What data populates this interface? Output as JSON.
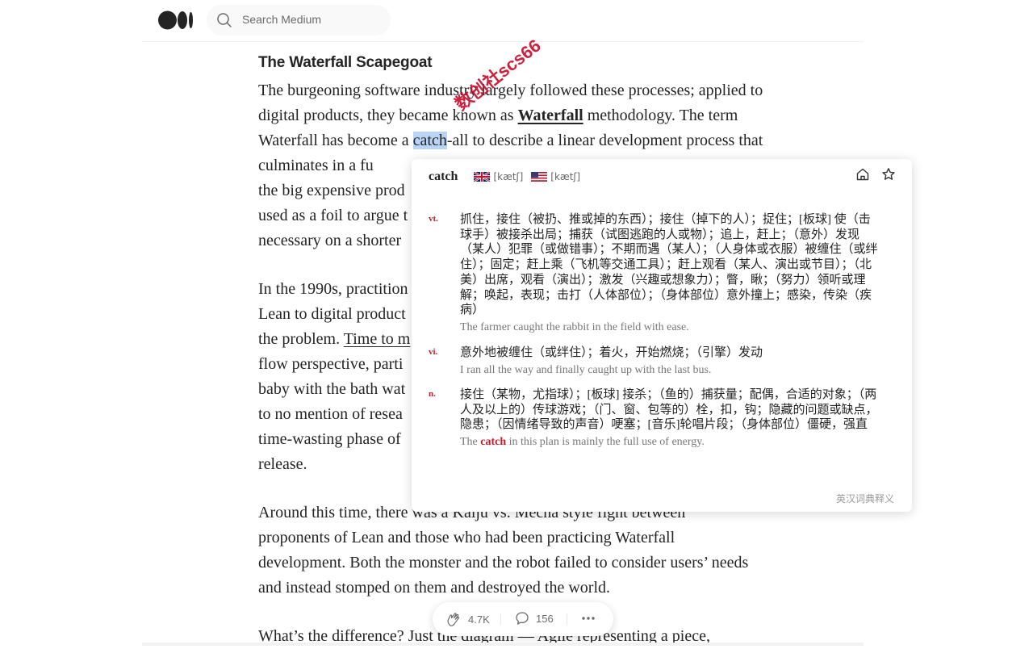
{
  "header": {
    "logo_icon": "medium-logo-icon",
    "search_placeholder": "Search Medium"
  },
  "article": {
    "section_title": "The Waterfall Scapegoat",
    "p1": {
      "t1": "The burgeoning software industry largely followed these processes; applied to digital products, they became known as ",
      "link": "Waterfall",
      "t2": " methodology. The term Waterfall has become a ",
      "highlight": "catch",
      "t3": "-all to describe a linear development process that culminates in a fu",
      "line5": "the big expensive prod",
      "line6": "used as a foil to argue t",
      "line7": "necessary on a shorter"
    },
    "p2": {
      "l1": "In the 1990s, practition",
      "l2": "Lean to digital product",
      "l3a": "the problem. ",
      "l3link": "Time to m",
      "l4": "flow perspective, parti",
      "l5": "baby with the bath wat",
      "l6": "to no mention of resea",
      "l7": "time-wasting phase of",
      "l8": "release."
    },
    "p3": {
      "l1": "Around this time, there was a Kaiju vs. Mecha style fight between",
      "l2": "proponents of Lean and those who had been practicing Waterfall",
      "l3": "development. Both the monster and the robot failed to consider users’ needs",
      "l4": "and instead stomped on them and destroyed the world."
    },
    "p4": {
      "l1": "What’s the difference? Just the diagram — Agile representing a piece,"
    }
  },
  "watermark": "数创社scs66",
  "dictionary": {
    "word": "catch",
    "uk_phonetic": "[kætʃ]",
    "us_phonetic": "[kætʃ]",
    "entries": [
      {
        "pos": "vt.",
        "meaning": "抓住，接住（被扔、推或掉的东西）；接住（掉下的人）；捉住；[板球] 使（击球手）被接杀出局；捕获（试图逃跑的人或物）；追上，赶上；（意外）发现（某人）犯罪（或做错事）；不期而遇（某人）；（人身体或衣服）被缠住（或绊住）；固定；赶上乘（飞机等交通工具）；赶上观看（某人、演出或节目）；（北美）出席，观看（演出）；激发（兴趣或想象力）；瞥，瞅；（努力）领听或理解；唤起，表现；击打（人体部位）；（身体部位）意外撞上；感染，传染（疾病）",
        "example": "The farmer caught the rabbit in the field with ease."
      },
      {
        "pos": "vi.",
        "meaning": "意外地被缠住（或绊住）；着火，开始燃烧；（引擎）发动",
        "example": "I ran all the way and finally caught up with the last bus."
      },
      {
        "pos": "n.",
        "meaning": "接住（某物，尤指球）；[板球] 接杀；（鱼的）捕获量；配偶，合适的对象；（两人及以上的）传球游戏；（门、窗、包等的）栓，扣，钩；隐藏的问题或缺点，隐患；（因情绪导致的声音）哽塞；[音乐]轮唱片段；（身体部位）僵硬，强直",
        "example_pre": "The ",
        "example_bold": "catch",
        "example_post": " in this plan is mainly the full use of energy."
      }
    ],
    "source": "英汉词典释义"
  },
  "actions": {
    "claps": "4.7K",
    "comments": "156"
  }
}
